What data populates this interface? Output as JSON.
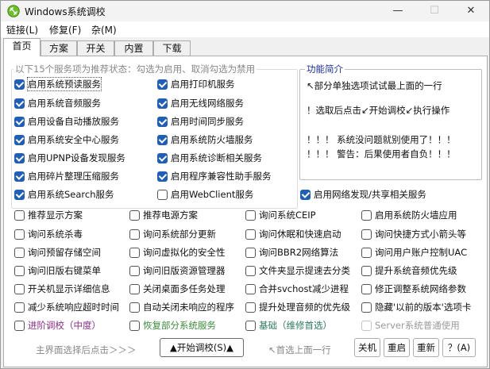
{
  "window": {
    "title": "Windows系统调校",
    "controls": {
      "minimize": "—",
      "maximize": "☐",
      "close": "✕"
    }
  },
  "menu": [
    {
      "label": "链接(L)"
    },
    {
      "label": "修复(F)"
    },
    {
      "label": "杂(M)"
    }
  ],
  "tabs": [
    {
      "label": "首页",
      "active": true
    },
    {
      "label": "方案"
    },
    {
      "label": "开关"
    },
    {
      "label": "内置"
    },
    {
      "label": "下载"
    }
  ],
  "recommended": {
    "caption": "以下15个服务项为推荐状态：勾选为启用、取消勾选为禁用",
    "col1": [
      {
        "label": "启用系统预读服务",
        "checked": true,
        "focused": true
      },
      {
        "label": "启用系统音频服务",
        "checked": true
      },
      {
        "label": "启用设备自动播放服务",
        "checked": true
      },
      {
        "label": "启用系统安全中心服务",
        "checked": true
      },
      {
        "label": "启用UPNP设备发现服务",
        "checked": true
      },
      {
        "label": "启用碎片整理压缩服务",
        "checked": true
      },
      {
        "label": "启用系统Search服务",
        "checked": true
      }
    ],
    "col2": [
      {
        "label": "启用打印机服务",
        "checked": true
      },
      {
        "label": "启用无线网络服务",
        "checked": true
      },
      {
        "label": "启用时间同步服务",
        "checked": true
      },
      {
        "label": "启用系统防火墙服务",
        "checked": true
      },
      {
        "label": "启用系统诊断相关服务",
        "checked": true
      },
      {
        "label": "启用程序兼容性助手服务",
        "checked": true
      },
      {
        "label": "启用WebClient服务",
        "checked": false
      }
    ],
    "extra": {
      "label": "启用网络发现/共享相关服务",
      "checked": true
    }
  },
  "info": {
    "title": "功能简介",
    "lines": [
      "↖部分单独选项试试最上面的一行",
      "！选取后点击↙开始调校↙执行操作",
      "！！！ 系统没问题就别使用了！！！",
      "！！！ 警告：后果使用者自负！！！"
    ]
  },
  "options": [
    [
      {
        "label": "推荐显示方案"
      },
      {
        "label": "询问系统杀毒"
      },
      {
        "label": "询问预留存储空间"
      },
      {
        "label": "询问旧版右键菜单"
      },
      {
        "label": "开关机显示详细信息"
      },
      {
        "label": "减少系统响应超时时间"
      },
      {
        "label": "进阶调校（中度）",
        "color": "purple"
      }
    ],
    [
      {
        "label": "推荐电源方案"
      },
      {
        "label": "询问系统部分更新"
      },
      {
        "label": "询问虚拟化的安全性"
      },
      {
        "label": "询问旧版资源管理器"
      },
      {
        "label": "关闭桌面多任务处理"
      },
      {
        "label": "自动关闭未响应的程序"
      },
      {
        "label": "恢复部分系统服务",
        "color": "green"
      }
    ],
    [
      {
        "label": "询问系统CEIP"
      },
      {
        "label": "询问休眠和快速启动"
      },
      {
        "label": "询问BBR2网络算法"
      },
      {
        "label": "文件夹显示提速去分类"
      },
      {
        "label": "合并svchost减少进程"
      },
      {
        "label": "提升处理音频的优先级"
      },
      {
        "label": "基础（维修首选）",
        "color": "teal"
      }
    ],
    [
      {
        "label": "启用系统防火墙应用"
      },
      {
        "label": "询问快捷方式小箭头等"
      },
      {
        "label": "询问用户账户控制UAC"
      },
      {
        "label": "提升系统音频优先级"
      },
      {
        "label": "修正调整系统网络参数"
      },
      {
        "label": "隐藏'以前的版本'选项卡"
      },
      {
        "label": "Server系统普通使用",
        "disabled": true
      }
    ]
  ],
  "bottom": {
    "hint_left": "主界面选择后点击＞＞＞",
    "start_button": "▲开始调校(S)▲",
    "hint_right": "↖首选上面一行",
    "shutdown": "关机",
    "restart": "重启",
    "reselect": "重新",
    "help": "？(A)"
  }
}
